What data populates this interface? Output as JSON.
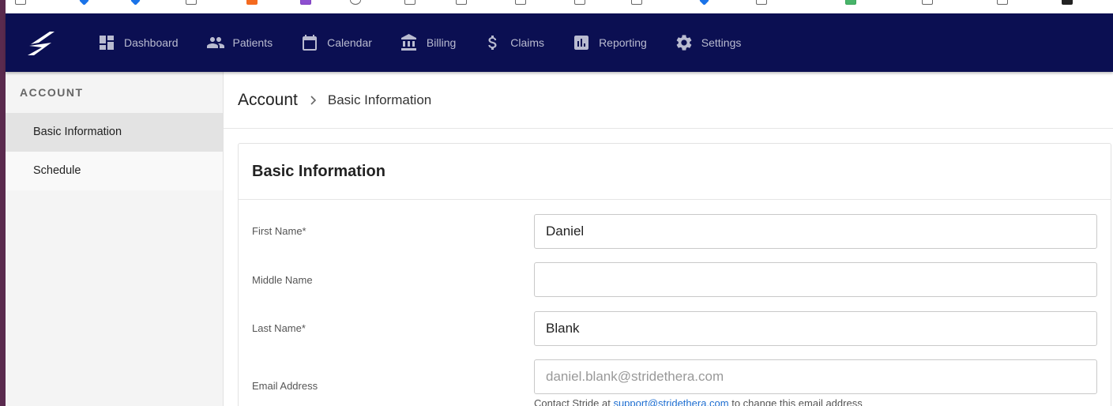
{
  "nav": {
    "items": [
      {
        "label": "Dashboard",
        "icon": "dashboard-icon"
      },
      {
        "label": "Patients",
        "icon": "people-icon"
      },
      {
        "label": "Calendar",
        "icon": "calendar-icon"
      },
      {
        "label": "Billing",
        "icon": "bank-icon"
      },
      {
        "label": "Claims",
        "icon": "dollar-icon"
      },
      {
        "label": "Reporting",
        "icon": "bar-chart-icon"
      },
      {
        "label": "Settings",
        "icon": "gear-icon"
      }
    ]
  },
  "sidebar": {
    "heading": "ACCOUNT",
    "items": [
      {
        "label": "Basic Information",
        "active": true
      },
      {
        "label": "Schedule",
        "active": false
      }
    ]
  },
  "breadcrumb": {
    "root": "Account",
    "current": "Basic Information"
  },
  "card": {
    "title": "Basic Information"
  },
  "form": {
    "first_name": {
      "label": "First Name*",
      "value": "Daniel"
    },
    "middle_name": {
      "label": "Middle Name",
      "value": ""
    },
    "last_name": {
      "label": "Last Name*",
      "value": "Blank"
    },
    "email": {
      "label": "Email Address",
      "placeholder": "daniel.blank@stridethera.com",
      "helper_prefix": "Contact Stride at ",
      "helper_link": "support@stridethera.com",
      "helper_suffix": " to change this email address"
    }
  },
  "colors": {
    "navbar": "#0b0f52",
    "nav_text": "#b9bbd0",
    "link": "#1f6fd1"
  }
}
